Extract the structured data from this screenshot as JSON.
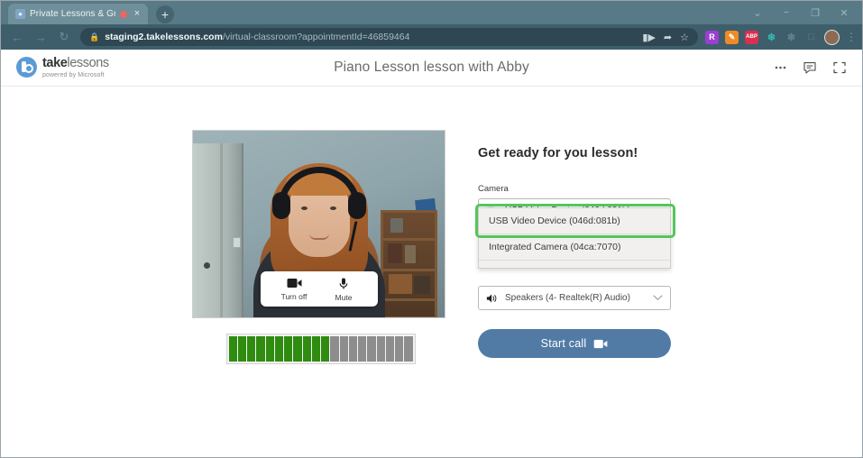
{
  "browser": {
    "tab": {
      "title": "Private Lessons & Group Cla",
      "favicon_name": "site-favicon",
      "recording_indicator": "recording-dot",
      "close_label": "×"
    },
    "new_tab_label": "+",
    "window_controls": [
      "⌄",
      "−",
      "❐",
      "✕"
    ],
    "nav": {
      "back": "←",
      "forward": "→",
      "reload": "↻"
    },
    "address": {
      "lock": "🔒",
      "host": "staging2.takelessons.com",
      "path": "/virtual-classroom?appointmentId=46859464"
    },
    "omnibox_actions": [
      "media-cast-icon",
      "collections-icon",
      "favorite-star-icon"
    ],
    "extensions": [
      {
        "name": "extension-r",
        "glyph": "R",
        "color": "#9b3fd4"
      },
      {
        "name": "extension-orange",
        "glyph": "✎",
        "color": "#f08a24"
      },
      {
        "name": "extension-abp",
        "glyph": "ABP",
        "color": "#d9304f"
      },
      {
        "name": "extension-teal",
        "glyph": "⁂",
        "color": "#35b8b0"
      },
      {
        "name": "extension-faded",
        "glyph": "✱",
        "color": "transparent"
      },
      {
        "name": "extension-square",
        "glyph": "□",
        "color": "transparent"
      }
    ],
    "profile_avatar": "profile-avatar",
    "browser_menu": "⋮"
  },
  "header": {
    "logo": {
      "take": "take",
      "lessons": "lessons",
      "tagline": "powered by Microsoft"
    },
    "title": "Piano Lesson lesson with Abby",
    "actions": [
      {
        "name": "more-options-icon",
        "glyph": "···"
      },
      {
        "name": "chat-icon",
        "glyph": "chat"
      },
      {
        "name": "fullscreen-icon",
        "glyph": "fullscreen"
      }
    ]
  },
  "video": {
    "controls": [
      {
        "name": "turn-off-camera-button",
        "label": "Turn off",
        "icon": "video-camera-icon"
      },
      {
        "name": "mute-microphone-button",
        "label": "Mute",
        "icon": "microphone-icon"
      }
    ],
    "audio_meter": {
      "total_segments": 20,
      "active_segments": 11,
      "on_color": "#2f8c10",
      "off_color": "#8d8d8d"
    }
  },
  "setup": {
    "heading": "Get ready for you lesson!",
    "camera_label": "Camera",
    "camera_selected": "USB Video Device (046d:081b)",
    "camera_icon": "video-camera-icon",
    "camera_options": [
      "USB Video Device (046d:081b)",
      "Integrated Camera (04ca:7070)"
    ],
    "highlighted_option_index": 0,
    "highlight_color": "#55c65a",
    "speaker_selected": "Speakers (4- Realtek(R) Audio)",
    "speaker_icon": "speaker-icon",
    "start_call_label": "Start call",
    "start_call_icon": "video-camera-icon",
    "start_call_color": "#517ba5",
    "chevron": "⌄"
  }
}
